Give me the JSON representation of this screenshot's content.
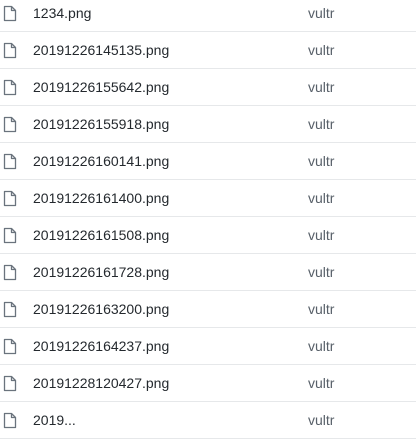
{
  "file_list": {
    "rows": [
      {
        "icon": "file-icon",
        "name": "1234.png",
        "commit_message": "vultr"
      },
      {
        "icon": "file-icon",
        "name": "20191226145135.png",
        "commit_message": "vultr"
      },
      {
        "icon": "file-icon",
        "name": "20191226155642.png",
        "commit_message": "vultr"
      },
      {
        "icon": "file-icon",
        "name": "20191226155918.png",
        "commit_message": "vultr"
      },
      {
        "icon": "file-icon",
        "name": "20191226160141.png",
        "commit_message": "vultr"
      },
      {
        "icon": "file-icon",
        "name": "20191226161400.png",
        "commit_message": "vultr"
      },
      {
        "icon": "file-icon",
        "name": "20191226161508.png",
        "commit_message": "vultr"
      },
      {
        "icon": "file-icon",
        "name": "20191226161728.png",
        "commit_message": "vultr"
      },
      {
        "icon": "file-icon",
        "name": "20191226163200.png",
        "commit_message": "vultr"
      },
      {
        "icon": "file-icon",
        "name": "20191226164237.png",
        "commit_message": "vultr"
      },
      {
        "icon": "file-icon",
        "name": "20191228120427.png",
        "commit_message": "vultr"
      },
      {
        "icon": "file-icon",
        "name": "2019...",
        "commit_message": "vultr"
      }
    ]
  },
  "colors": {
    "text": "#24292e",
    "muted_text": "#586069",
    "icon": "#6a737d",
    "divider": "#e6e8ea"
  }
}
